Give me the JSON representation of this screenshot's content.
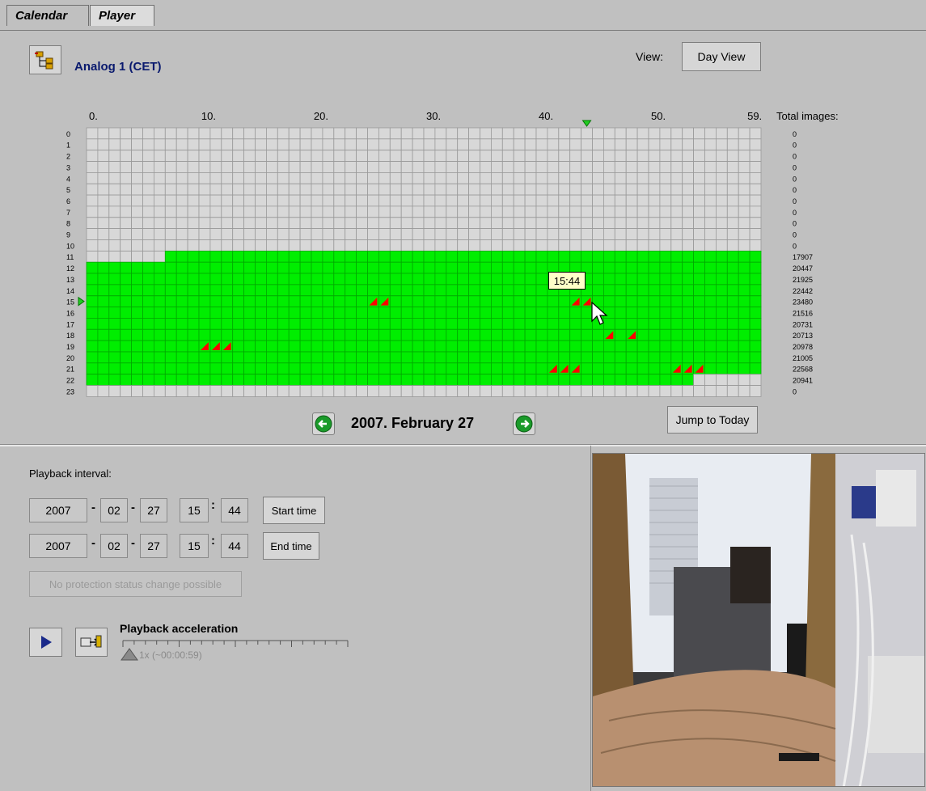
{
  "tabs": [
    {
      "label": "Calendar",
      "active": false
    },
    {
      "label": "Player",
      "active": true
    }
  ],
  "header": {
    "camera_title": "Analog 1  (CET)",
    "view_label": "View:",
    "view_button": "Day View"
  },
  "calendar": {
    "x_ticks": [
      "0.",
      "10.",
      "20.",
      "30.",
      "40.",
      "50.",
      "59."
    ],
    "hours": [
      "0",
      "1",
      "2",
      "3",
      "4",
      "5",
      "6",
      "7",
      "8",
      "9",
      "10",
      "11",
      "12",
      "13",
      "14",
      "15",
      "16",
      "17",
      "18",
      "19",
      "20",
      "21",
      "22",
      "23"
    ],
    "total_label": "Total images:",
    "totals": [
      "0",
      "0",
      "0",
      "0",
      "0",
      "0",
      "0",
      "0",
      "0",
      "0",
      "0",
      "17907",
      "20447",
      "21925",
      "22442",
      "23480",
      "21516",
      "20731",
      "20713",
      "20978",
      "21005",
      "22568",
      "20941",
      "0"
    ],
    "tooltip": "15:44",
    "cursor_row": 15,
    "cursor_col": 44,
    "recorded": {
      "11": [
        7,
        59
      ],
      "12": [
        0,
        59
      ],
      "13": [
        0,
        59
      ],
      "14": [
        0,
        59
      ],
      "15": [
        0,
        59
      ],
      "16": [
        0,
        59
      ],
      "17": [
        0,
        59
      ],
      "18": [
        0,
        59
      ],
      "19": [
        0,
        59
      ],
      "20": [
        0,
        59
      ],
      "21": [
        0,
        59
      ],
      "22": [
        0,
        53
      ]
    },
    "events": [
      {
        "row": 15,
        "cols": [
          25,
          26,
          43,
          44
        ]
      },
      {
        "row": 18,
        "cols": [
          46,
          48
        ]
      },
      {
        "row": 19,
        "cols": [
          10,
          11,
          12
        ]
      },
      {
        "row": 21,
        "cols": [
          41,
          42,
          43,
          52,
          53,
          54
        ]
      }
    ],
    "date": "2007. February 27",
    "jump_button": "Jump to Today"
  },
  "playback": {
    "interval_label": "Playback interval:",
    "start": {
      "year": "2007",
      "month": "02",
      "day": "27",
      "hour": "15",
      "minute": "44",
      "button": "Start time"
    },
    "end": {
      "year": "2007",
      "month": "02",
      "day": "27",
      "hour": "15",
      "minute": "44",
      "button": "End time"
    },
    "protection_button": "No protection status change possible",
    "accel_label": "Playback acceleration",
    "accel_value": "1x (~00:00:59)"
  },
  "colors": {
    "recorded": "#00ee00",
    "empty": "#d8d8d8",
    "event": "#ff0000",
    "title": "#0a1a6e"
  }
}
